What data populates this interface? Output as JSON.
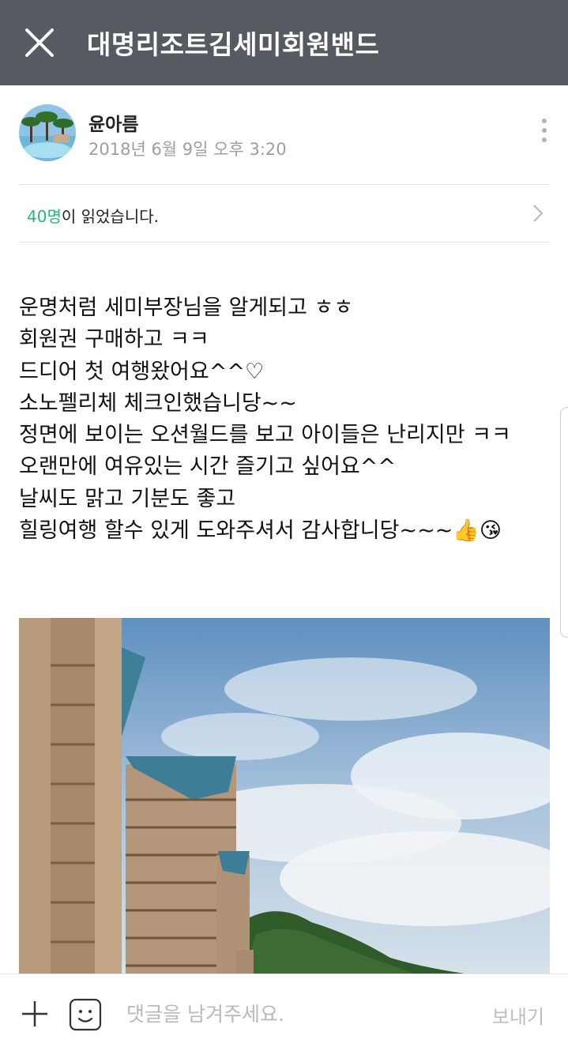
{
  "header": {
    "title": "대명리조트김세미회원밴드",
    "close_icon": "close-icon"
  },
  "author": {
    "name": "윤아름",
    "timestamp": "2018년 6월 9일 오후 3:20",
    "avatar_icon": "avatar-photo",
    "more_icon": "more-vertical-icon"
  },
  "read_status": {
    "count": "40명",
    "suffix": "이 읽었습니다.",
    "chevron_icon": "chevron-right-icon"
  },
  "post": {
    "lines": [
      "운명처럼 세미부장님을 알게되고 ㅎㅎ",
      "회원권 구매하고 ㅋㅋ",
      "드디어 첫 여행왔어요^^♡",
      "소노펠리체 체크인했습니당~~",
      "정면에 보이는 오션월드를 보고 아이들은 난리지만 ㅋㅋ",
      "오랜만에 여유있는 시간 즐기고 싶어요^^",
      "날씨도 맑고 기분도 좋고",
      "힐링여행 할수 있게 도와주셔서 감사합니당~~~👍😘"
    ],
    "photo_icon": "resort-photo"
  },
  "footer": {
    "placeholder": "댓글을 남겨주세요.",
    "send_label": "보내기",
    "plus_icon": "plus-icon",
    "emoji_icon": "emoji-icon"
  },
  "colors": {
    "header_bg": "#555b61",
    "accent": "#2bb673",
    "muted": "#9e9e9e"
  }
}
